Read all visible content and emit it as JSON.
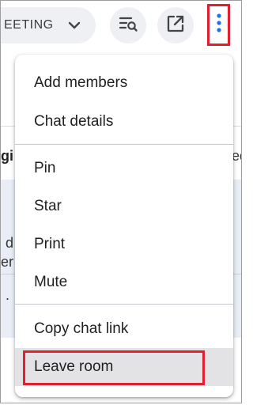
{
  "header": {
    "meeting_label": "EETING",
    "search_icon": "filter-search-icon",
    "popout_icon": "open-in-new-window-icon",
    "more_icon": "more-vertical-icon"
  },
  "background": {
    "frag_gi": "gi",
    "frag_ed": "ed",
    "frag_d": "d",
    "frag_er": "er",
    "frag_dot": "."
  },
  "menu": {
    "items": [
      {
        "label": "Add members"
      },
      {
        "label": "Chat details"
      },
      {
        "label": "Pin"
      },
      {
        "label": "Star"
      },
      {
        "label": "Print"
      },
      {
        "label": "Mute"
      },
      {
        "label": "Copy chat link"
      },
      {
        "label": "Leave room"
      }
    ]
  },
  "colors": {
    "highlight_border": "#e0202e",
    "accent_blue": "#1a73e8",
    "hover_bg": "#e3e3e5"
  }
}
